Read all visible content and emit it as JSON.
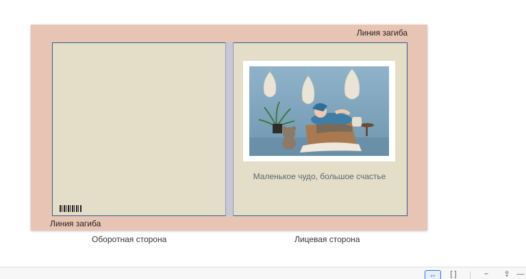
{
  "cover": {
    "fold_line_top": "Линия загиба",
    "fold_line_bottom": "Линия загиба",
    "caption": "Маленькое чудо, большое счастье",
    "back_side_label": "Оборотная сторона",
    "front_side_label": "Лицевая сторона"
  },
  "colors": {
    "bleed": "#e8c4b4",
    "cover_paper": "#e4ddc8",
    "spine": "#c8c8d4",
    "trim_line": "#2e5f8a",
    "accent": "#2f6fd6"
  },
  "toolbar": {
    "fit_icon": "↔",
    "fullscreen_icon": "[ ]",
    "zoom_out_icon": "−",
    "upload_icon": "⇪",
    "more_icon": "—"
  }
}
